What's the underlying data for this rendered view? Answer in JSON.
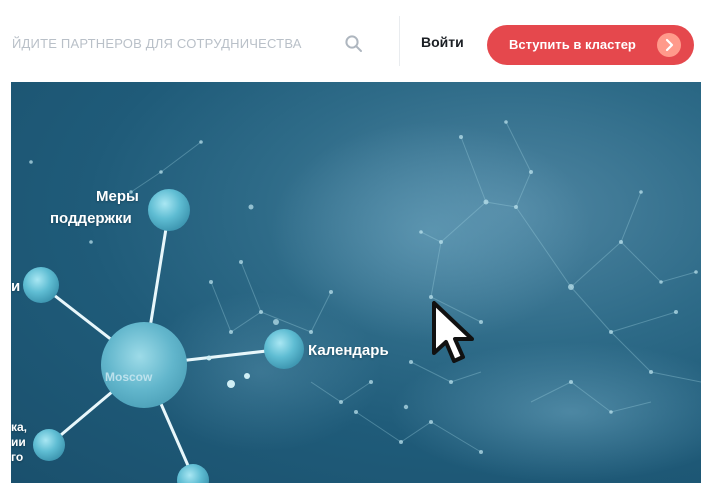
{
  "header": {
    "search_placeholder": "ЙДИТЕ ПАРТНЕРОВ ДЛЯ СОТРУДНИЧЕСТВА",
    "login_label": "Войти",
    "cta_label": "Вступить в кластер"
  },
  "hero": {
    "label_support_line1": "Меры",
    "label_support_line2": "поддержки",
    "label_calendar": "Календарь",
    "center_node_label": "Moscow",
    "left_label_1": "и",
    "left_label_2": "ка,",
    "left_label_3": "ии",
    "left_label_4": "го"
  },
  "colors": {
    "accent": "#e5484d",
    "hero_bg": "#2e6b88",
    "node": "#6ec7dc"
  },
  "icons": {
    "search": "search-icon",
    "arrow": "chevron-right-icon",
    "cursor": "mouse-pointer-icon"
  }
}
